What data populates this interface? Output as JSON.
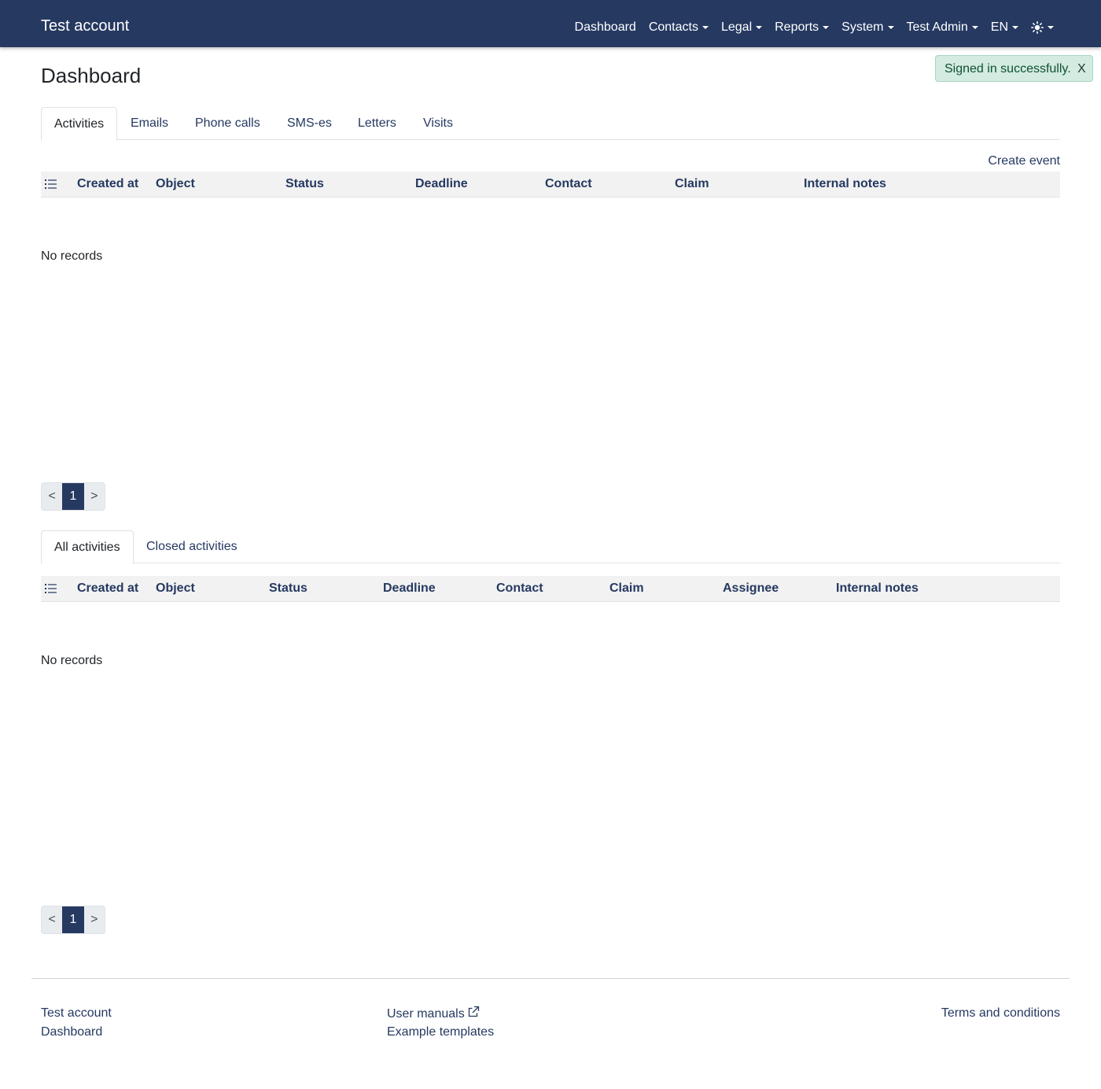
{
  "navbar": {
    "brand": "Test account",
    "items": [
      {
        "label": "Dashboard",
        "dropdown": false
      },
      {
        "label": "Contacts",
        "dropdown": true
      },
      {
        "label": "Legal",
        "dropdown": true
      },
      {
        "label": "Reports",
        "dropdown": true
      },
      {
        "label": "System",
        "dropdown": true
      },
      {
        "label": "Test Admin",
        "dropdown": true
      },
      {
        "label": "EN",
        "dropdown": true
      }
    ],
    "theme_icon": "sun-icon",
    "color": "#253961"
  },
  "page": {
    "title": "Dashboard"
  },
  "toast": {
    "message": "Signed in successfully.",
    "close_label": "X"
  },
  "events": {
    "tabs": [
      "Activities",
      "Emails",
      "Phone calls",
      "SMS-es",
      "Letters",
      "Visits"
    ],
    "active_tab": "Activities",
    "create_label": "Create event",
    "columns": [
      "Created at",
      "Object",
      "Status",
      "Deadline",
      "Contact",
      "Claim",
      "Internal notes"
    ],
    "empty_text": "No records",
    "pagination": {
      "prev": "<",
      "current": "1",
      "next": ">"
    }
  },
  "activities": {
    "tabs": [
      "All activities",
      "Closed activities"
    ],
    "active_tab": "All activities",
    "columns": [
      "Created at",
      "Object",
      "Status",
      "Deadline",
      "Contact",
      "Claim",
      "Assignee",
      "Internal notes"
    ],
    "empty_text": "No records",
    "pagination": {
      "prev": "<",
      "current": "1",
      "next": ">"
    }
  },
  "footer": {
    "col1": [
      "Test account",
      "Dashboard"
    ],
    "user_manuals": "User manuals",
    "example_templates": "Example templates",
    "terms": "Terms and conditions"
  }
}
